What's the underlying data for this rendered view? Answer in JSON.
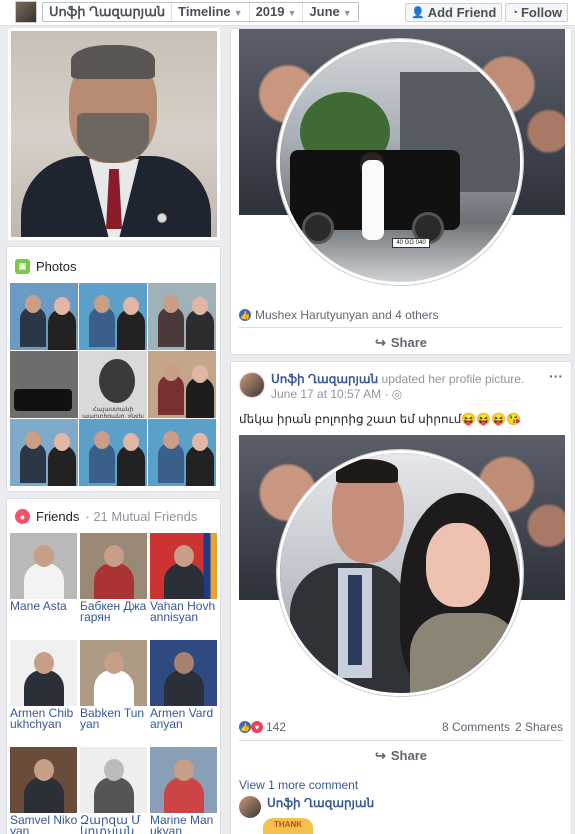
{
  "topbar": {
    "name": "Սոֆի Ղազարյան",
    "timeline_label": "Timeline",
    "year_label": "2019",
    "month_label": "June",
    "add_friend_label": "Add Friend",
    "follow_label": "Follow"
  },
  "photos": {
    "title": "Photos",
    "caption": "Հայաստանի պարտիզանը, ջնջել Տեղեկատվական"
  },
  "friends": {
    "title": "Friends",
    "mutual": "21 Mutual Friends",
    "list": [
      {
        "name": "Mane Asta"
      },
      {
        "name": "Бабкен Джагарян"
      },
      {
        "name": "Vahan Hovhannisyan"
      },
      {
        "name": "Armen Chibukhchyan"
      },
      {
        "name": "Babken Tunyan"
      },
      {
        "name": "Armen Vardanyan"
      },
      {
        "name": "Samvel Nikoyan"
      },
      {
        "name": "Զարզա Մկրտչյան"
      },
      {
        "name": "Marine Manukyan"
      }
    ]
  },
  "post1": {
    "plate": "40 GG 040",
    "likes_text": "Mushex Harutyunyan and 4 others",
    "share_label": "Share"
  },
  "post2": {
    "author": "Սոֆի Ղազարյան",
    "action": "updated her profile picture.",
    "time": "June 17 at 10:57 AM",
    "text": "մեկա իրան բոլորից շատ եմ սիրում😝😝😝😘",
    "reactions_count": "142",
    "comments": "8 Comments",
    "shares": "2 Shares",
    "share_label": "Share",
    "view_more": "View 1 more comment",
    "commenter": "Սոֆի Ղազարյան",
    "sticker_text": "THANK"
  },
  "colors": {
    "link": "#365899",
    "background": "#e9ebee",
    "like_blue": "#4267b2",
    "love_red": "#f33e58"
  }
}
